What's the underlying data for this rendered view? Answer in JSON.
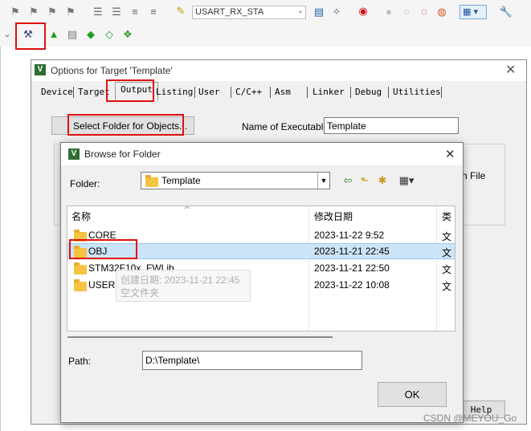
{
  "toolbar": {
    "target_select_value": "USART_RX_STA",
    "icons_row1": [
      "bookmark-icon",
      "bookmark-prev-icon",
      "bookmark-next-icon",
      "bookmark-clear-icon",
      "indent-icon",
      "unindent-icon",
      "comment-icon",
      "uncomment-icon",
      "open-file-icon"
    ],
    "icons_row1_right": [
      "find-in-files-icon",
      "debug-icon",
      "magnify-icon",
      "breakpoint-icon",
      "breakpoint-disabled-icon",
      "kill-breakpoints-icon",
      "breakpoints-all-icon",
      "window-layout-icon",
      "configure-icon"
    ],
    "icons_row2": [
      "magic-wand-icon",
      "load-icon",
      "manage-components-icon",
      "pack-installer-icon",
      "select-software-packs-icon",
      "run-time-env-icon"
    ]
  },
  "options_dialog": {
    "title": "Options for Target 'Template'",
    "tabs": [
      "Device",
      "Target",
      "Output",
      "Listing",
      "User",
      "C/C++",
      "Asm",
      "Linker",
      "Debug",
      "Utilities"
    ],
    "active_tab": "Output",
    "select_folder_button": "Select Folder for Objects...",
    "exe_label": "Name of Executable:",
    "exe_value": "Template",
    "partial_text": "ch File",
    "help_button": "Help"
  },
  "browse_dialog": {
    "title": "Browse for Folder",
    "folder_label": "Folder:",
    "folder_value": "Template",
    "columns": [
      "名称",
      "修改日期",
      "类"
    ],
    "rows": [
      {
        "name": "CORE",
        "date": "2023-11-22 9:52",
        "type": "文"
      },
      {
        "name": "OBJ",
        "date": "2023-11-21 22:45",
        "type": "文",
        "selected": true
      },
      {
        "name": "STM32F10x_FWLib",
        "date": "2023-11-21 22:50",
        "type": "文"
      },
      {
        "name": "USER",
        "date": "2023-11-22 10:08",
        "type": "文"
      }
    ],
    "tooltip_line1": "创建日期: 2023-11-21 22:45",
    "tooltip_line2": "空文件夹",
    "path_label": "Path:",
    "path_value": "D:\\Template\\",
    "ok_button": "OK"
  },
  "watermark": "CSDN @MEYOU_Go"
}
